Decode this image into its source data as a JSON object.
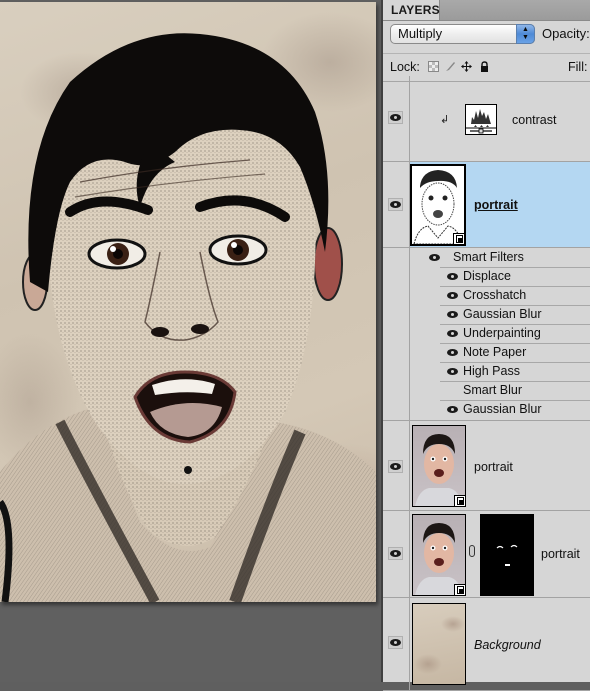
{
  "panel": {
    "tab_label": "LAYERS",
    "blend_mode": "Multiply",
    "opacity_label": "Opacity:",
    "lock_label": "Lock:",
    "fill_label": "Fill:",
    "lock_icons": [
      "lock-transparent-pixels-icon",
      "lock-image-pixels-icon",
      "lock-position-icon",
      "lock-all-icon"
    ]
  },
  "layers": [
    {
      "name": "contrast",
      "type": "adjustment",
      "adjustment_icon": "levels-icon",
      "clipped": true,
      "visible": true,
      "selected": false
    },
    {
      "name": "portrait",
      "type": "smart-object",
      "visible": true,
      "selected": true,
      "smart_filters_label": "Smart Filters",
      "filters": [
        {
          "name": "Displace",
          "visible": true
        },
        {
          "name": "Crosshatch",
          "visible": true
        },
        {
          "name": "Gaussian Blur",
          "visible": true
        },
        {
          "name": "Underpainting",
          "visible": true
        },
        {
          "name": "Note Paper",
          "visible": true
        },
        {
          "name": "High Pass",
          "visible": true
        },
        {
          "name": "Smart Blur",
          "visible": false
        },
        {
          "name": "Gaussian Blur",
          "visible": true
        }
      ]
    },
    {
      "name": "portrait",
      "type": "smart-object",
      "visible": true,
      "selected": false
    },
    {
      "name": "portrait",
      "type": "smart-object-with-mask",
      "visible": true,
      "selected": false,
      "mask_linked": true
    },
    {
      "name": "Background",
      "type": "background",
      "visible": true,
      "selected": false
    }
  ],
  "colors": {
    "selected_row": "#b4d7f2",
    "panel_bg": "#d6d6d6",
    "workspace_bg": "#606060"
  }
}
